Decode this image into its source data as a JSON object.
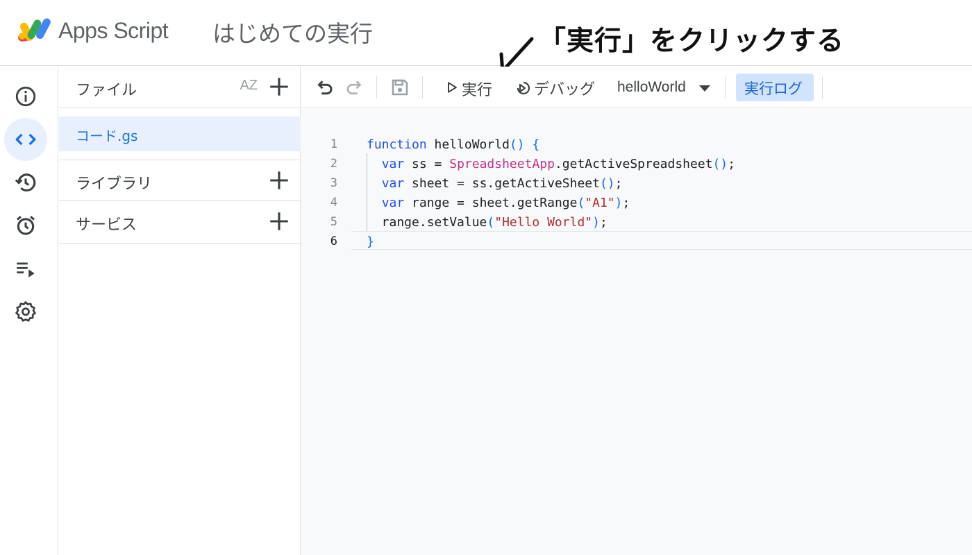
{
  "header": {
    "app_name": "Apps Script",
    "project_title": "はじめての実行",
    "annotation": "「実行」をクリックする"
  },
  "rail": {
    "items": [
      {
        "icon": "info-icon",
        "label": "概要"
      },
      {
        "icon": "code-icon",
        "label": "エディタ",
        "active": true
      },
      {
        "icon": "history-icon",
        "label": "変更履歴"
      },
      {
        "icon": "alarm-icon",
        "label": "トリガー"
      },
      {
        "icon": "executions-icon",
        "label": "実行数"
      },
      {
        "icon": "gear-icon",
        "label": "プロジェクトの設定"
      }
    ]
  },
  "files_panel": {
    "files_label": "ファイル",
    "sort_label": "AZ",
    "file_name": "コード.gs",
    "libraries_label": "ライブラリ",
    "services_label": "サービス"
  },
  "toolbar": {
    "run_label": "実行",
    "debug_label": "デバッグ",
    "function_name": "helloWorld",
    "log_label": "実行ログ"
  },
  "editor": {
    "line_numbers": [
      "1",
      "2",
      "3",
      "4",
      "5",
      "6"
    ],
    "current_line": 6
  },
  "colors": {
    "keyword": "#1f4ff3",
    "class": "#c1338b",
    "string": "#b03030",
    "active_bg": "#e8f0fe",
    "accent": "#1a73e8"
  }
}
